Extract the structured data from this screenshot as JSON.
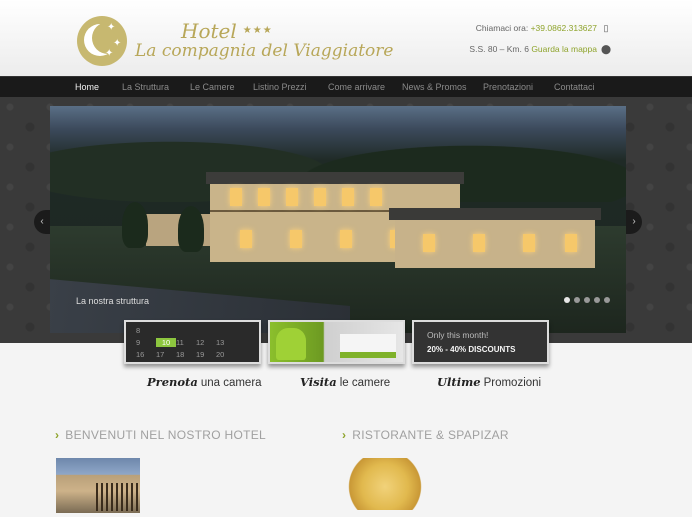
{
  "logo": {
    "hotel": "Hotel",
    "stars": "★★★",
    "name": "La compagnia del Viaggiatore"
  },
  "contact": {
    "phone_prefix": "Chiamaci ora: ",
    "phone": "+39.0862.313627",
    "address": "S.S. 80 – Km. 6 ",
    "map_link": "Guarda la mappa"
  },
  "nav": [
    {
      "label": "Home",
      "active": true
    },
    {
      "label": "La Struttura"
    },
    {
      "label": "Le Camere"
    },
    {
      "label": "Listino Prezzi"
    },
    {
      "label": "Come arrivare"
    },
    {
      "label": "News & Promos"
    },
    {
      "label": "Prenotazioni"
    },
    {
      "label": "Contattaci"
    }
  ],
  "slider": {
    "caption": "La nostra struttura",
    "slide_count": 5,
    "active_slide": 1,
    "prev": "‹",
    "next": "›"
  },
  "calendar": [
    "8",
    "",
    "",
    "",
    "",
    "9",
    "10",
    "11",
    "12",
    "13",
    "16",
    "17",
    "18",
    "19",
    "20"
  ],
  "promo": {
    "line1": "Only this month!",
    "line2": "20% - 40% DISCOUNTS"
  },
  "tiles": [
    {
      "em": "Prenota",
      "text": "una camera"
    },
    {
      "em": "Visita",
      "text": "le camere"
    },
    {
      "em": "Ultime",
      "text": "Promozioni"
    }
  ],
  "sections": [
    {
      "title": "BENVENUTI NEL NOSTRO HOTEL"
    },
    {
      "title": "RISTORANTE & SPAPIZAR"
    }
  ],
  "colors": {
    "accent": "#8fa42d",
    "gold": "#b8a759",
    "nav_bg": "#1a1a1a"
  }
}
